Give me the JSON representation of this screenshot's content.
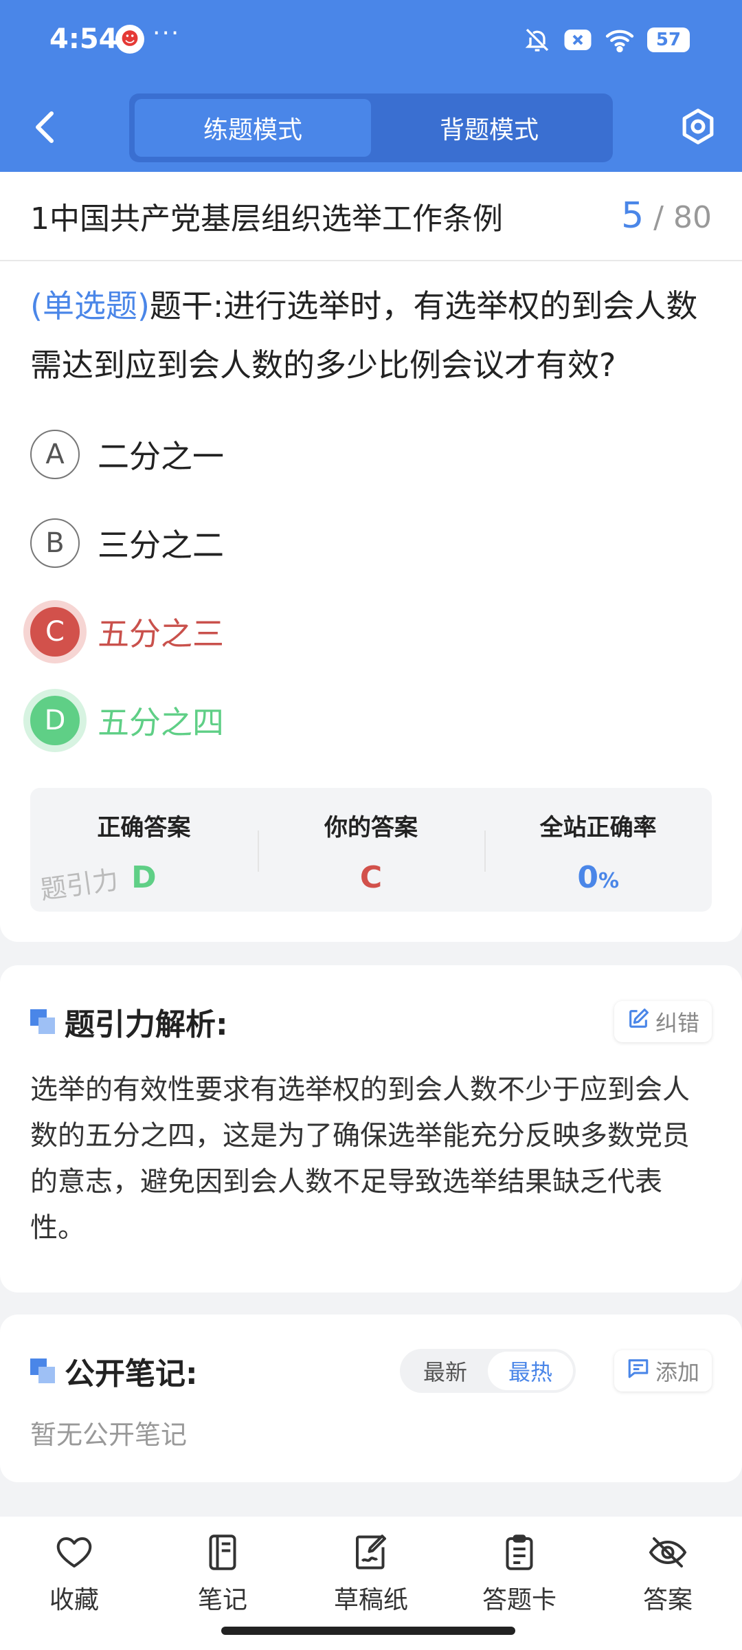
{
  "status_bar": {
    "time": "4:54",
    "more": "···",
    "battery": "57"
  },
  "header": {
    "tabs": [
      {
        "label": "练题模式",
        "active": true
      },
      {
        "label": "背题模式",
        "active": false
      }
    ]
  },
  "question": {
    "title": "1中国共产党基层组织选举工作条例",
    "current": "5",
    "separator": "/",
    "total": "80",
    "type": "(单选题)",
    "stem": "题干:进行选举时，有选举权的到会人数需达到应到会人数的多少比例会议才有效?",
    "options": [
      {
        "letter": "A",
        "text": "二分之一",
        "state": "normal"
      },
      {
        "letter": "B",
        "text": "三分之二",
        "state": "normal"
      },
      {
        "letter": "C",
        "text": "五分之三",
        "state": "wrong"
      },
      {
        "letter": "D",
        "text": "五分之四",
        "state": "correct"
      }
    ]
  },
  "result": {
    "correct_label": "正确答案",
    "correct_value": "D",
    "yours_label": "你的答案",
    "yours_value": "C",
    "rate_label": "全站正确率",
    "rate_value": "0",
    "rate_unit": "%",
    "watermark": "题引力"
  },
  "analysis": {
    "title": "题引力解析:",
    "report_label": "纠错",
    "text": "选举的有效性要求有选举权的到会人数不少于应到会人数的五分之四，这是为了确保选举能充分反映多数党员的意志，避免因到会人数不足导致选举结果缺乏代表性。"
  },
  "notes": {
    "title": "公开笔记:",
    "sort_latest": "最新",
    "sort_hot": "最热",
    "add_label": "添加",
    "empty": "暂无公开笔记"
  },
  "bottom_tabs": [
    {
      "label": "收藏",
      "icon": "heart-icon"
    },
    {
      "label": "笔记",
      "icon": "notebook-icon"
    },
    {
      "label": "草稿纸",
      "icon": "draft-icon"
    },
    {
      "label": "答题卡",
      "icon": "clipboard-icon"
    },
    {
      "label": "答案",
      "icon": "eye-off-icon"
    }
  ],
  "colors": {
    "primary": "#4a86e8",
    "wrong": "#d2514b",
    "correct": "#5fcf86"
  }
}
